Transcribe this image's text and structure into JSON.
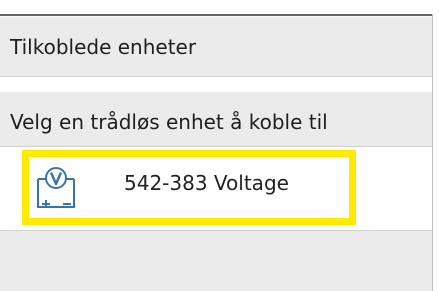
{
  "sections": {
    "connected_devices_title": "Tilkoblede enheter",
    "choose_device_title": "Velg en trådløs enhet å koble til"
  },
  "device": {
    "label": "542-383  Voltage",
    "icon": "voltage-sensor-icon",
    "highlight_color": "#ffeb00"
  }
}
